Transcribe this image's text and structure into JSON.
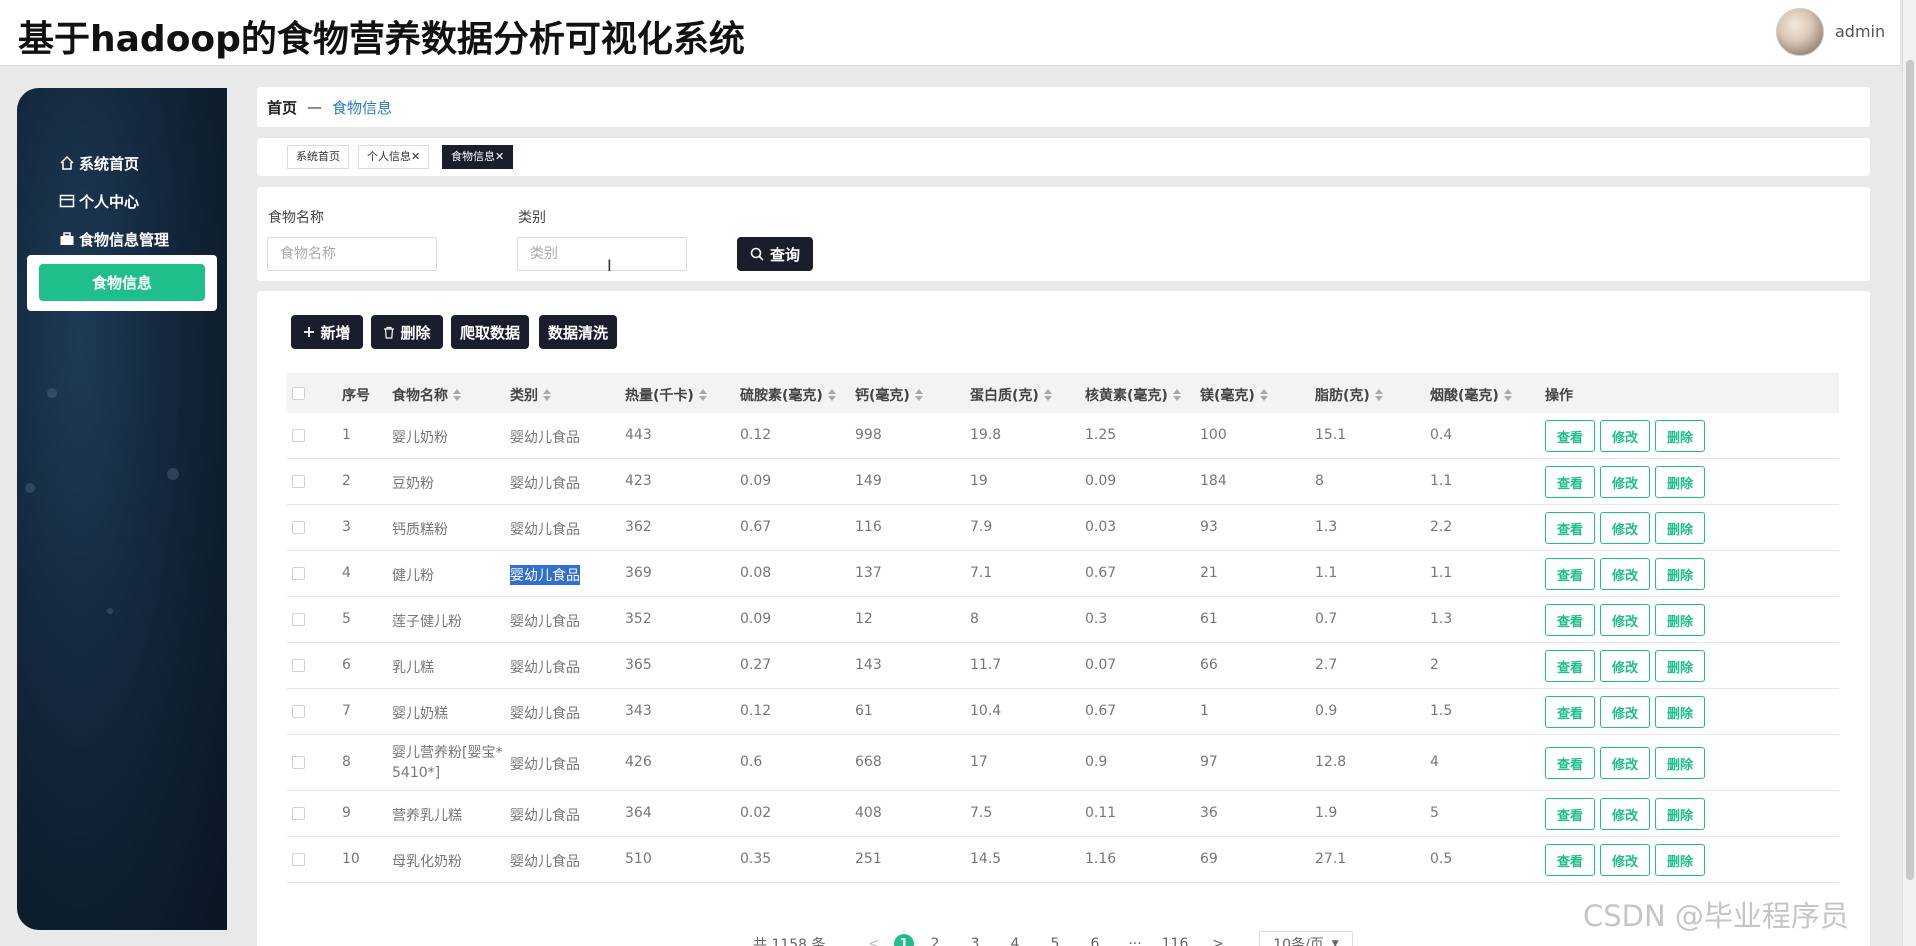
{
  "app": {
    "title": "基于hadoop的食物营养数据分析可视化系统",
    "user": "admin"
  },
  "sidebar": {
    "items": [
      {
        "label": "系统首页",
        "icon": "home-icon"
      },
      {
        "label": "个人中心",
        "icon": "id-card-icon"
      },
      {
        "label": "食物信息管理",
        "icon": "briefcase-icon"
      }
    ],
    "active": "食物信息"
  },
  "breadcrumb": {
    "home": "首页",
    "separator": "—",
    "current": "食物信息"
  },
  "tabs": [
    {
      "label": "系统首页"
    },
    {
      "label": "个人信息",
      "close": "✕"
    },
    {
      "label": "食物信息",
      "close": "✕"
    }
  ],
  "filter": {
    "name_label": "食物名称",
    "name_placeholder": "食物名称",
    "category_label": "类别",
    "category_placeholder": "类别",
    "query": "查询"
  },
  "actions": {
    "add": "新增",
    "delete": "删除",
    "crawl": "爬取数据",
    "clean": "数据清洗"
  },
  "table": {
    "headers": [
      "序号",
      "食物名称",
      "类别",
      "热量(千卡)",
      "硫胺素(毫克)",
      "钙(毫克)",
      "蛋白质(克)",
      "核黄素(毫克)",
      "镁(毫克)",
      "脂肪(克)",
      "烟酸(毫克)",
      "操作"
    ],
    "row_ops": {
      "view": "查看",
      "edit": "修改",
      "delete": "删除"
    },
    "rows": [
      {
        "no": "1",
        "name": "婴儿奶粉",
        "name2": "",
        "cat": "婴幼儿食品",
        "kcal": "443",
        "thiamine": "0.12",
        "calcium": "998",
        "protein": "19.8",
        "riboflavin": "1.25",
        "magnesium": "100",
        "fat": "15.1",
        "niacin": "0.4"
      },
      {
        "no": "2",
        "name": "豆奶粉",
        "name2": "",
        "cat": "婴幼儿食品",
        "kcal": "423",
        "thiamine": "0.09",
        "calcium": "149",
        "protein": "19",
        "riboflavin": "0.09",
        "magnesium": "184",
        "fat": "8",
        "niacin": "1.1"
      },
      {
        "no": "3",
        "name": "钙质糕粉",
        "name2": "",
        "cat": "婴幼儿食品",
        "kcal": "362",
        "thiamine": "0.67",
        "calcium": "116",
        "protein": "7.9",
        "riboflavin": "0.03",
        "magnesium": "93",
        "fat": "1.3",
        "niacin": "2.2"
      },
      {
        "no": "4",
        "name": "健儿粉",
        "name2": "",
        "cat": "婴幼儿食品",
        "kcal": "369",
        "thiamine": "0.08",
        "calcium": "137",
        "protein": "7.1",
        "riboflavin": "0.67",
        "magnesium": "21",
        "fat": "1.1",
        "niacin": "1.1"
      },
      {
        "no": "5",
        "name": "莲子健儿粉",
        "name2": "",
        "cat": "婴幼儿食品",
        "kcal": "352",
        "thiamine": "0.09",
        "calcium": "12",
        "protein": "8",
        "riboflavin": "0.3",
        "magnesium": "61",
        "fat": "0.7",
        "niacin": "1.3"
      },
      {
        "no": "6",
        "name": "乳儿糕",
        "name2": "",
        "cat": "婴幼儿食品",
        "kcal": "365",
        "thiamine": "0.27",
        "calcium": "143",
        "protein": "11.7",
        "riboflavin": "0.07",
        "magnesium": "66",
        "fat": "2.7",
        "niacin": "2"
      },
      {
        "no": "7",
        "name": "婴儿奶糕",
        "name2": "",
        "cat": "婴幼儿食品",
        "kcal": "343",
        "thiamine": "0.12",
        "calcium": "61",
        "protein": "10.4",
        "riboflavin": "0.67",
        "magnesium": "1",
        "fat": "0.9",
        "niacin": "1.5"
      },
      {
        "no": "8",
        "name": "婴儿营养粉[婴宝*",
        "name2": "5410*]",
        "cat": "婴幼儿食品",
        "kcal": "426",
        "thiamine": "0.6",
        "calcium": "668",
        "protein": "17",
        "riboflavin": "0.9",
        "magnesium": "97",
        "fat": "12.8",
        "niacin": "4"
      },
      {
        "no": "9",
        "name": "营养乳儿糕",
        "name2": "",
        "cat": "婴幼儿食品",
        "kcal": "364",
        "thiamine": "0.02",
        "calcium": "408",
        "protein": "7.5",
        "riboflavin": "0.11",
        "magnesium": "36",
        "fat": "1.9",
        "niacin": "5"
      },
      {
        "no": "10",
        "name": "母乳化奶粉",
        "name2": "",
        "cat": "婴幼儿食品",
        "kcal": "510",
        "thiamine": "0.35",
        "calcium": "251",
        "protein": "14.5",
        "riboflavin": "1.16",
        "magnesium": "69",
        "fat": "27.1",
        "niacin": "0.5"
      }
    ]
  },
  "pagination": {
    "total": "共 1158 条",
    "prev": "<",
    "pages": [
      "1",
      "2",
      "3",
      "4",
      "5",
      "6"
    ],
    "ellipsis": "···",
    "last": "116",
    "next": ">",
    "size": "10条/页"
  },
  "watermark": "CSDN @毕业程序员"
}
